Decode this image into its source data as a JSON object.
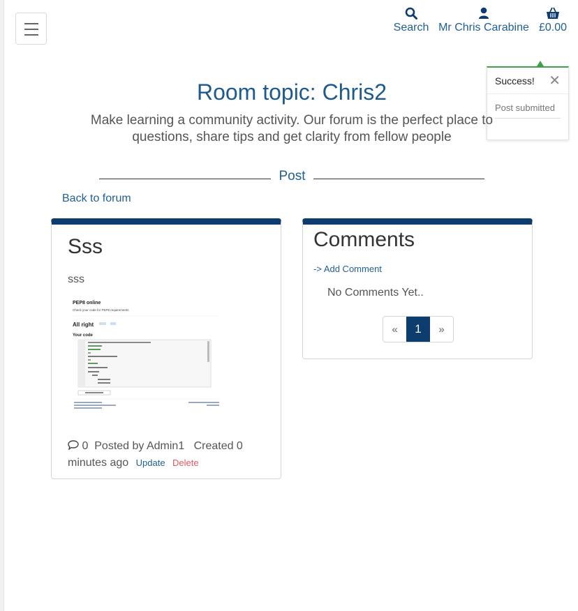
{
  "nav": {
    "search_label": "Search",
    "user_label": "Mr Chris Carabine",
    "basket_label": "£0.00",
    "accent_color": "#1f5f96"
  },
  "toast": {
    "title": "Success!",
    "close": "✕",
    "message": "Post submitted",
    "color": "#3fa34d"
  },
  "page": {
    "title": "Room topic: Chris2",
    "subtitle": "Make learning a community activity. Our forum is the perfect place to ask questions, share tips and get clarity from fellow people",
    "subtitle_line1": "Make learning a community activity. Our forum is the perfect place to",
    "subtitle_line2": "questions, share tips and get clarity from fellow people",
    "divider_label": "Post",
    "back_link": "Back to forum"
  },
  "post": {
    "title": "Sss",
    "body": "sss",
    "comment_count": "0",
    "posted_by": "Posted by Admin1",
    "created": "Created 0 minutes ago",
    "update_label": "Update",
    "delete_label": "Delete",
    "image": {
      "heading": "PEP8 online",
      "subheading": "Check your code for PEP8 requirements",
      "status": "All right",
      "code_label": "Your code"
    }
  },
  "comments": {
    "title": "Comments",
    "add_link": "-> Add Comment",
    "empty_text": "No Comments Yet..",
    "pagination": {
      "prev": "«",
      "current": "1",
      "next": "»"
    }
  },
  "colors": {
    "card_header": "#0d3c6e",
    "delete": "#e05a66"
  }
}
